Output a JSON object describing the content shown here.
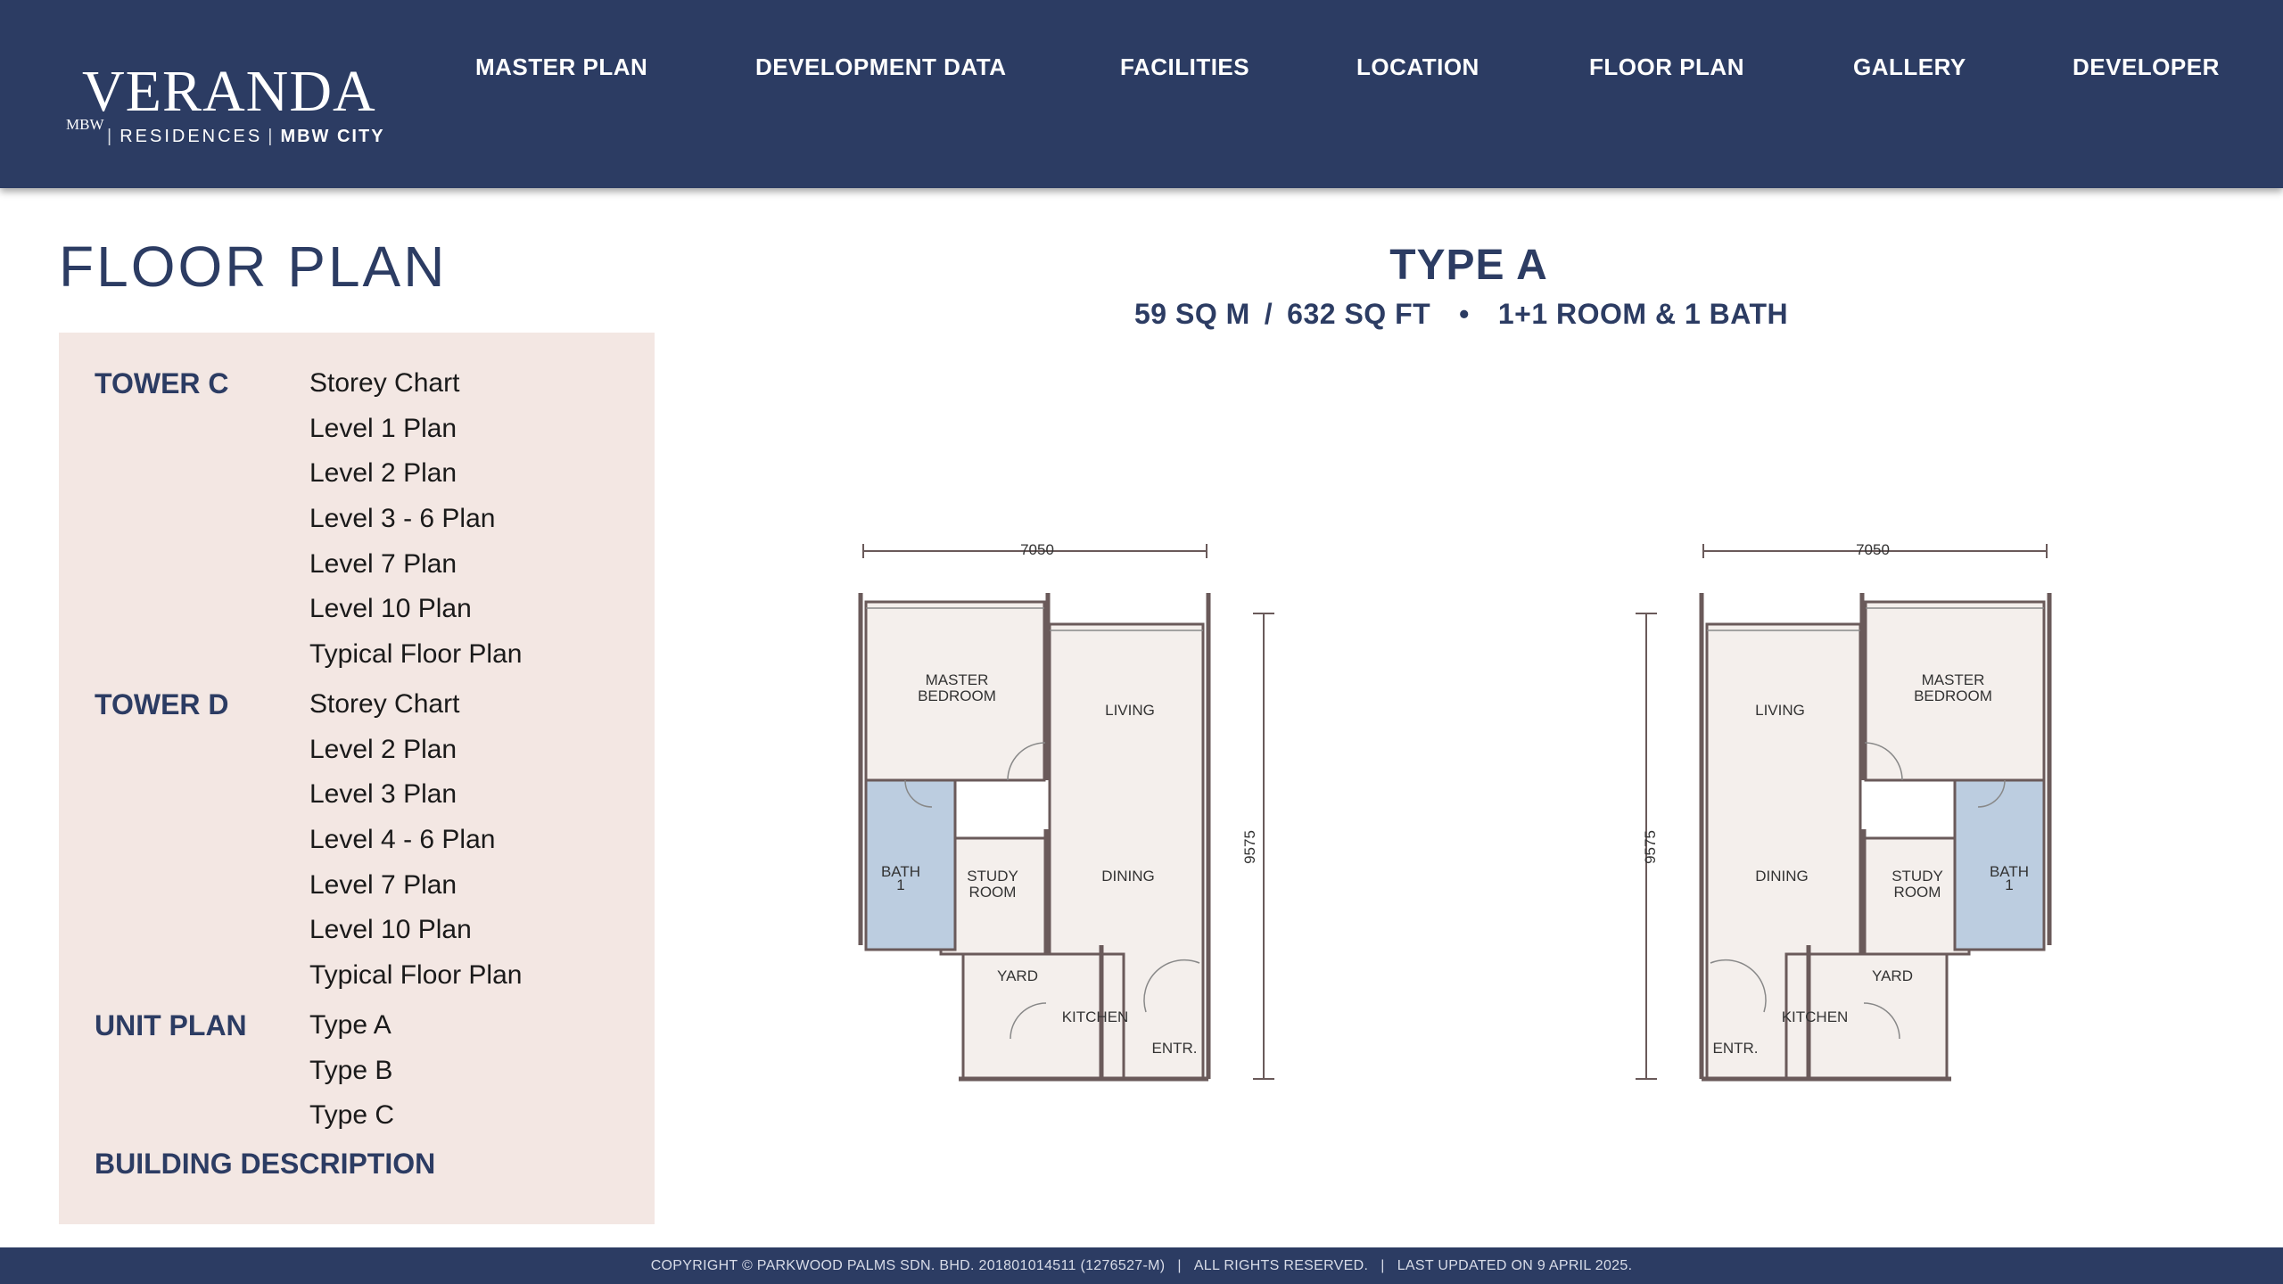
{
  "brand": {
    "name": "VERANDA",
    "mark": "MBW",
    "sub_residences": "RESIDENCES",
    "sub_city": "MBW CITY"
  },
  "nav": [
    {
      "label": "MASTER PLAN"
    },
    {
      "label": "DEVELOPMENT DATA"
    },
    {
      "label": "FACILITIES"
    },
    {
      "label": "LOCATION"
    },
    {
      "label": "FLOOR PLAN"
    },
    {
      "label": "GALLERY"
    },
    {
      "label": "DEVELOPER"
    }
  ],
  "page_title": "FLOOR PLAN",
  "sidebar": {
    "groups": [
      {
        "title": "TOWER C",
        "links": [
          "Storey Chart",
          "Level 1 Plan",
          "Level 2 Plan",
          "Level 3 - 6 Plan",
          "Level 7 Plan",
          "Level 10 Plan",
          "Typical Floor Plan"
        ]
      },
      {
        "title": "TOWER D",
        "links": [
          "Storey Chart",
          "Level 2 Plan",
          "Level 3 Plan",
          "Level 4 - 6 Plan",
          "Level 7 Plan",
          "Level 10 Plan",
          "Typical Floor Plan"
        ]
      },
      {
        "title": "UNIT PLAN",
        "links": [
          "Type A",
          "Type B",
          "Type C"
        ]
      },
      {
        "title": "BUILDING DESCRIPTION",
        "links": []
      }
    ]
  },
  "unit": {
    "title": "TYPE A",
    "sqm": "59 SQ M",
    "slash": "/",
    "sqft": "632 SQ FT",
    "bullet": "•",
    "rooms": "1+1 ROOM & 1 BATH"
  },
  "plan_labels": {
    "width_dim": "7050",
    "depth_dim": "9575",
    "master_1": "MASTER",
    "master_2": "BEDROOM",
    "living": "LIVING",
    "dining": "DINING",
    "study_1": "STUDY",
    "study_2": "ROOM",
    "bath_1": "BATH",
    "bath_2": "1",
    "yard": "YARD",
    "kitchen": "KITCHEN",
    "entr": "ENTR."
  },
  "colors": {
    "navy": "#2c3c63",
    "sidebar_bg": "#f3e7e3",
    "room_fill": "#f4efec",
    "bath_fill": "#bccde0"
  },
  "footer": {
    "copyright": "COPYRIGHT © PARKWOOD PALMS SDN. BHD. 201801014511 (1276527-M)",
    "sep": "|",
    "rights": "ALL RIGHTS RESERVED.",
    "updated": "LAST UPDATED ON 9 APRIL 2025."
  }
}
